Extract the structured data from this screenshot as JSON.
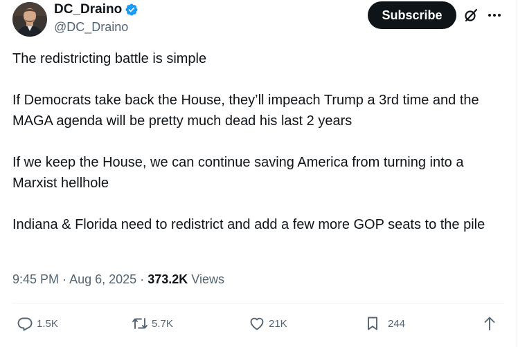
{
  "author": {
    "display_name": "DC_Draino",
    "handle": "@DC_Draino",
    "verified_color": "#1d9bf0"
  },
  "header": {
    "subscribe_label": "Subscribe",
    "grok_icon": "grok-icon",
    "more_icon": "more-icon"
  },
  "tweet": {
    "paragraphs": [
      "The redistricting battle is simple",
      "If Democrats take back the House, they’ll impeach Trump a 3rd time and the MAGA agenda will be pretty much dead his last 2 years",
      "If we keep the House, we can continue saving America from turning into a Marxist hellhole",
      "Indiana & Florida need to redistrict and add a few more GOP seats to the pile"
    ]
  },
  "meta": {
    "time": "9:45 PM",
    "separator": "·",
    "date": "Aug 6, 2025",
    "views_count": "373.2K",
    "views_label": "Views"
  },
  "actions": {
    "replies": "1.5K",
    "reposts": "5.7K",
    "likes": "21K",
    "bookmarks": "244"
  },
  "colors": {
    "text": "#0f1419",
    "secondary": "#536471",
    "border": "#eff3f4"
  }
}
